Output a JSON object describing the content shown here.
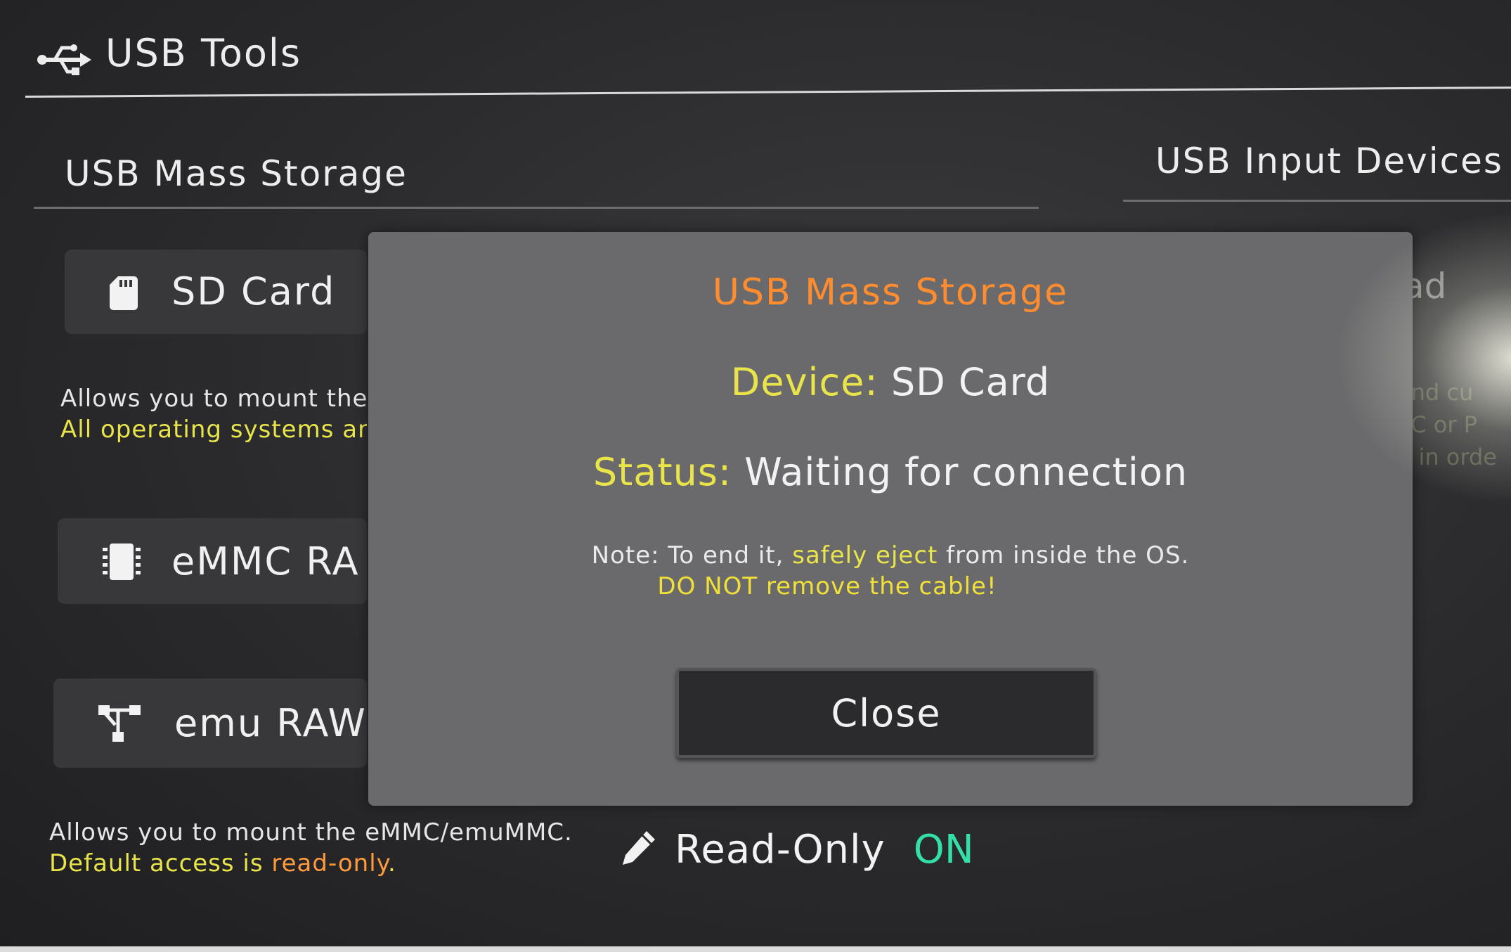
{
  "header": {
    "title": "USB Tools",
    "icon": "usb-icon"
  },
  "tabs": [
    {
      "label": "USB Mass Storage",
      "icon": ""
    },
    {
      "label": "USB Input Devices"
    }
  ],
  "menu": {
    "sd": {
      "label": "SD Card",
      "icon": "sd-card-icon"
    },
    "emmc": {
      "label": "eMMC RA",
      "icon": "chip-icon"
    },
    "emu": {
      "label": "emu RAW",
      "icon": "partition-icon"
    }
  },
  "sd_desc": {
    "line1": "Allows you to mount the S",
    "line2": "All operating systems are"
  },
  "emu_desc": {
    "line1": "Allows you to mount the eMMC/emuMMC.",
    "line2_prefix": "Default access is ",
    "line2_highlight": "read-only",
    "line2_suffix": "."
  },
  "ghost": {
    "tab_fragment": "ad",
    "lines": [
      "and cu",
      "PC or P",
      "n in orde"
    ]
  },
  "readonly": {
    "label": "Read-Only",
    "value": "ON",
    "icon": "pencil-icon"
  },
  "dialog": {
    "title": "USB Mass Storage",
    "device_label": "Device:",
    "device_value": "SD Card",
    "status_label": "Status:",
    "status_value": "Waiting for connection",
    "note_prefix": "Note: To end it, ",
    "note_highlight": "safely eject",
    "note_suffix": " from inside the OS.",
    "warning": "DO NOT remove the cable!",
    "close_label": "Close"
  },
  "colors": {
    "accent_orange": "#ff8c2e",
    "accent_yellow": "#e8e44a",
    "on_green": "#33e0a6"
  }
}
